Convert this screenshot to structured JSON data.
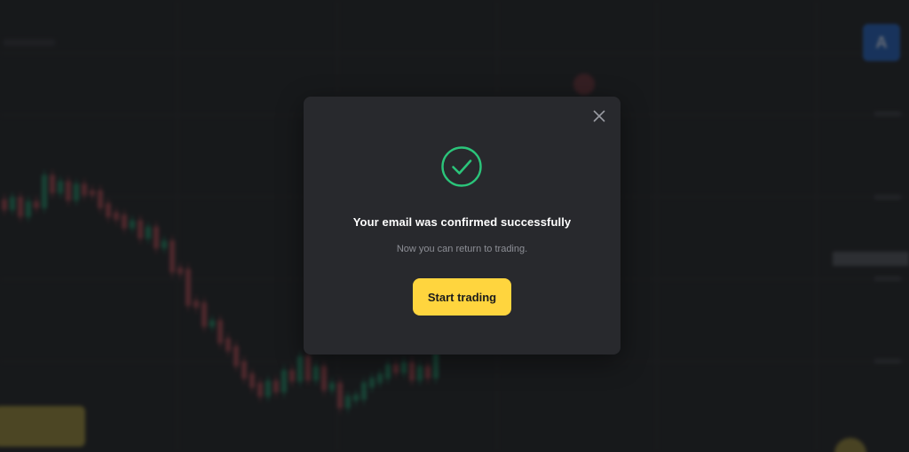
{
  "background": {
    "avatar_letter": "A",
    "colors": {
      "up_candle": "#1e8f66",
      "down_candle": "#b0474f",
      "grid": "#2a2b2f",
      "accent_blue": "#1f5fbf",
      "accent_yellow": "#ffd53e"
    }
  },
  "modal": {
    "close_icon": "close-icon",
    "status_icon": "check-circle-icon",
    "title": "Your email was confirmed successfully",
    "subtitle": "Now you can return to trading.",
    "button_label": "Start trading",
    "colors": {
      "background": "#28292d",
      "check": "#2bc47a",
      "button": "#ffd53e"
    }
  }
}
